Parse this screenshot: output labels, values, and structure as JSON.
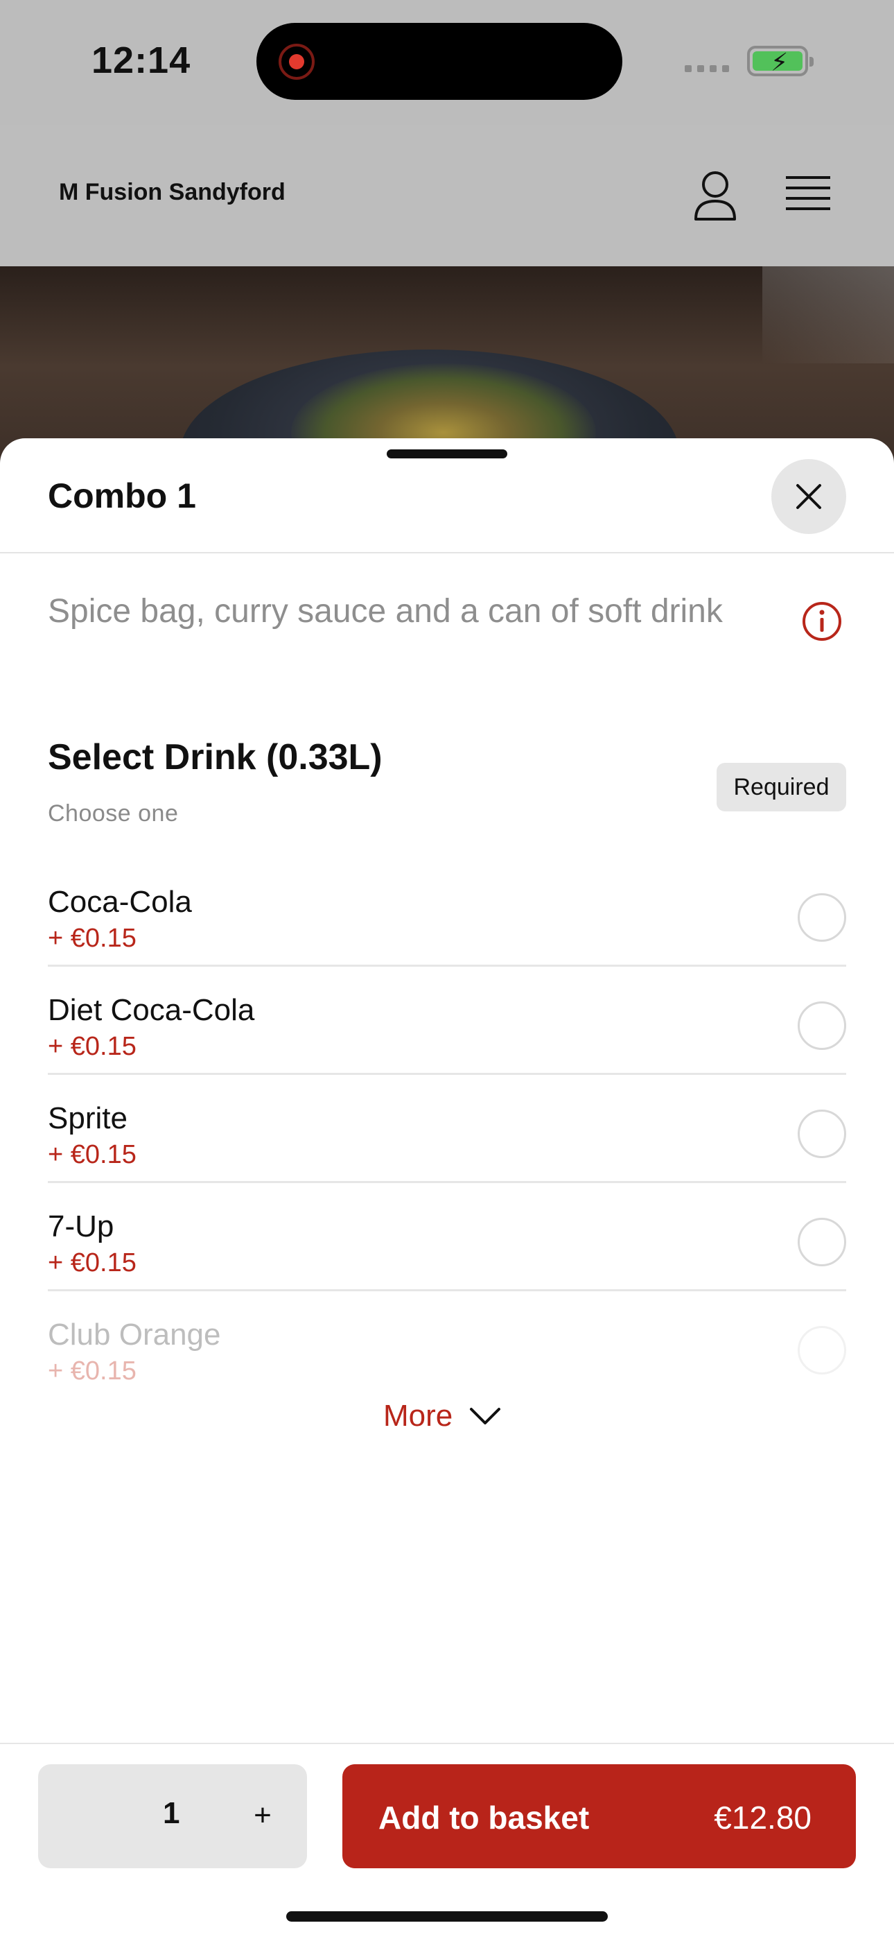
{
  "status_bar": {
    "time": "12:14"
  },
  "header": {
    "site_name": "M Fusion Sandyford"
  },
  "sheet": {
    "title": "Combo 1",
    "description": "Spice bag, curry sauce and a can of soft drink",
    "section": {
      "title": "Select Drink (0.33L)",
      "subtitle": "Choose one",
      "badge": "Required",
      "options": [
        {
          "name": "Coca-Cola",
          "price": "+ €0.15"
        },
        {
          "name": "Diet Coca-Cola",
          "price": "+ €0.15"
        },
        {
          "name": "Sprite",
          "price": "+ €0.15"
        },
        {
          "name": "7-Up",
          "price": "+ €0.15"
        },
        {
          "name": "Club Orange",
          "price": "+ €0.15"
        }
      ],
      "more_label": "More"
    },
    "footer": {
      "quantity": "1",
      "plus": "+",
      "add_label": "Add to basket",
      "total": "€12.80"
    }
  },
  "colors": {
    "accent": "#b8241a",
    "badge_bg": "#e6e6e6"
  },
  "icons": [
    "record-icon",
    "signal-icon",
    "battery-icon",
    "user-icon",
    "menu-icon",
    "close-icon",
    "info-icon",
    "chevron-down-icon"
  ]
}
